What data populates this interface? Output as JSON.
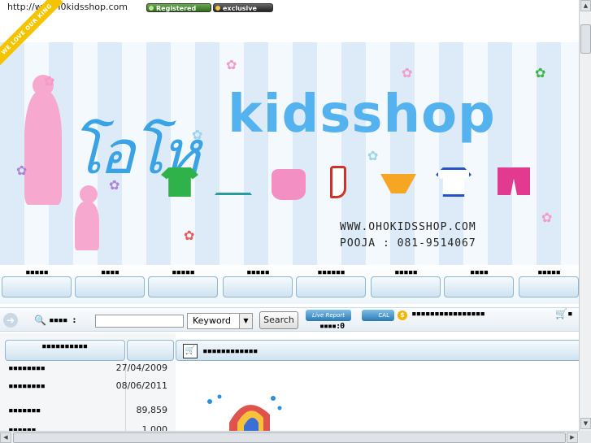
{
  "topbar": {
    "url_text": "http://w… H0kidsshop.com",
    "badge_registered": "Registered",
    "badge_exclusive": "exclusive"
  },
  "ribbon": {
    "text": "WE LOVE OUR KING"
  },
  "banner": {
    "logo_thai": "โอโห",
    "logo_text": "kidsshop",
    "url": "WWW.OHOKIDSSHOP.COM",
    "phone": "POOJA : 081-9514067"
  },
  "nav": {
    "tabs": [
      {
        "label": "▪▪▪▪▪"
      },
      {
        "label": "▪▪▪▪"
      },
      {
        "label": "▪▪▪▪▪"
      },
      {
        "label": "▪▪▪▪▪"
      },
      {
        "label": "▪▪▪▪▪▪"
      },
      {
        "label": "▪▪▪▪▪"
      },
      {
        "label": "▪▪▪▪"
      },
      {
        "label": "▪▪▪▪▪"
      }
    ]
  },
  "search": {
    "label": "▪▪▪▪ :",
    "input_value": "",
    "select_value": "Keyword",
    "button_label": "Search",
    "report_badge": "Live Report",
    "report_count": "▪▪▪▪:0",
    "cal_badge": "CAL",
    "coin_symbol": "$",
    "promo_text": "▪▪▪▪▪▪▪▪▪▪▪▪▪▪▪▪",
    "cart_text": "▪"
  },
  "left_panel": {
    "title": "▪▪▪▪▪▪▪▪▪▪",
    "rows": [
      {
        "key": "▪▪▪▪▪▪▪▪",
        "value": "27/04/2009"
      },
      {
        "key": "▪▪▪▪▪▪▪▪",
        "value": "08/06/2011"
      },
      {
        "key": "▪▪▪▪▪▪▪",
        "value": "89,859"
      },
      {
        "key": "▪▪▪▪▪▪",
        "value": "1,000"
      }
    ]
  },
  "main_panel": {
    "title": "▪▪▪▪▪▪▪▪▪▪▪▪"
  }
}
